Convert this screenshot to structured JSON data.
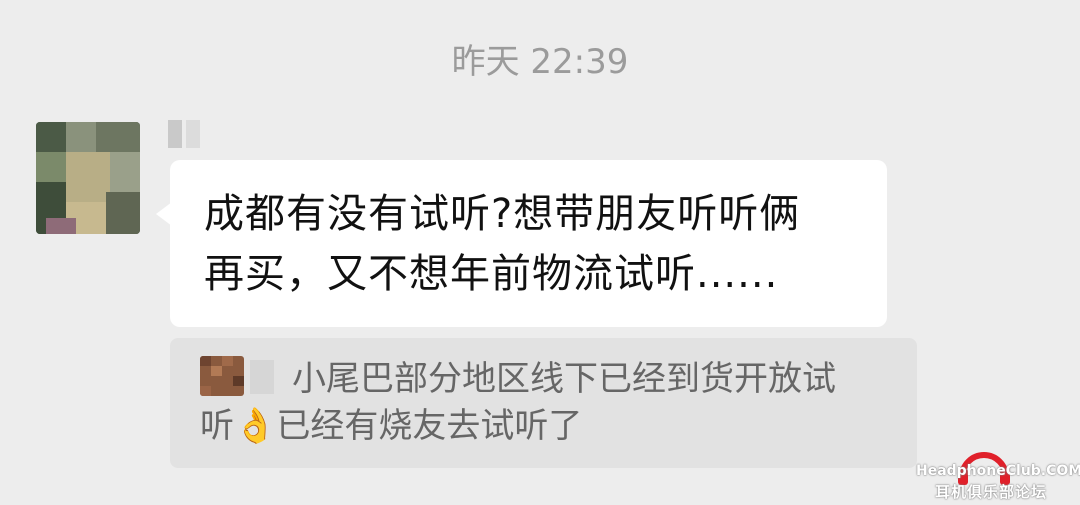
{
  "timestamp": "昨天 22:39",
  "message": {
    "line1": "成都有没有试听?想带朋友听听俩",
    "line2": "再买，又不想年前物流试听......"
  },
  "quote": {
    "line1": "小尾巴部分地区线下已经到货开放试",
    "line2_prefix": "听",
    "emoji": "👌",
    "line2_rest": "已经有烧友去试听了"
  },
  "watermark": {
    "site": "HeadphoneClub.COM",
    "cn": "耳机俱乐部论坛",
    "color": "#e0202a"
  }
}
